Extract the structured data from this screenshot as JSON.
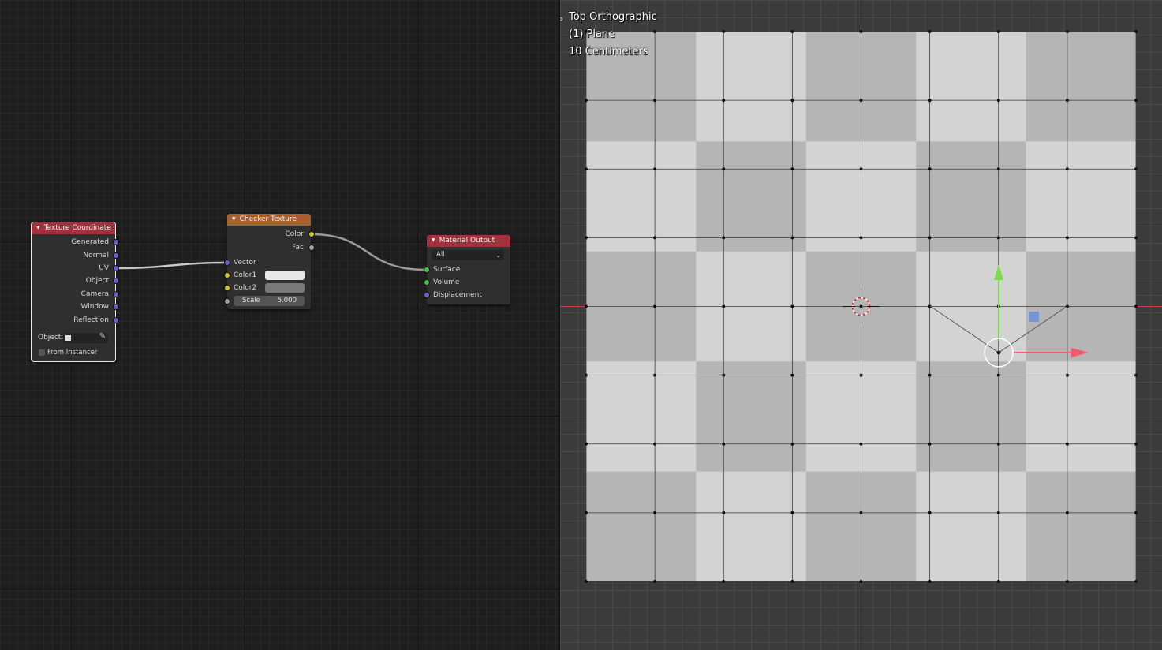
{
  "node_editor": {
    "nodes": {
      "texture_coordinate": {
        "title": "Texture Coordinate",
        "header_color": "#a1323d",
        "outputs": [
          "Generated",
          "Normal",
          "UV",
          "Object",
          "Camera",
          "Window",
          "Reflection"
        ],
        "object_label": "Object:",
        "from_instancer_label": "From Instancer",
        "from_instancer_checked": false
      },
      "checker_texture": {
        "title": "Checker Texture",
        "header_color": "#a8602e",
        "outputs": [
          "Color",
          "Fac"
        ],
        "inputs": [
          "Vector",
          "Color1",
          "Color2"
        ],
        "color1": "#e8e8e8",
        "color2": "#7a7a7a",
        "scale_label": "Scale",
        "scale_value": "5.000"
      },
      "material_output": {
        "title": "Material Output",
        "header_color": "#a1323d",
        "target": "All",
        "inputs": [
          "Surface",
          "Volume",
          "Displacement"
        ]
      }
    },
    "links": [
      "Texture Coordinate.UV -> Checker Texture.Vector",
      "Checker Texture.Color -> Material Output.Surface"
    ]
  },
  "viewport": {
    "view_name": "Top Orthographic",
    "object_name": "(1) Plane",
    "grid_scale": "10 Centimeters",
    "checker_light": "#d3d3d3",
    "checker_dark": "#b5b5b5",
    "axis_x_color": "#ff3352",
    "axis_y_color": "#8bdc00",
    "gizmo_y_color": "#7fd94d",
    "gizmo_x_color": "#f45b6a",
    "gizmo_plane_color": "#6a8fd8"
  }
}
